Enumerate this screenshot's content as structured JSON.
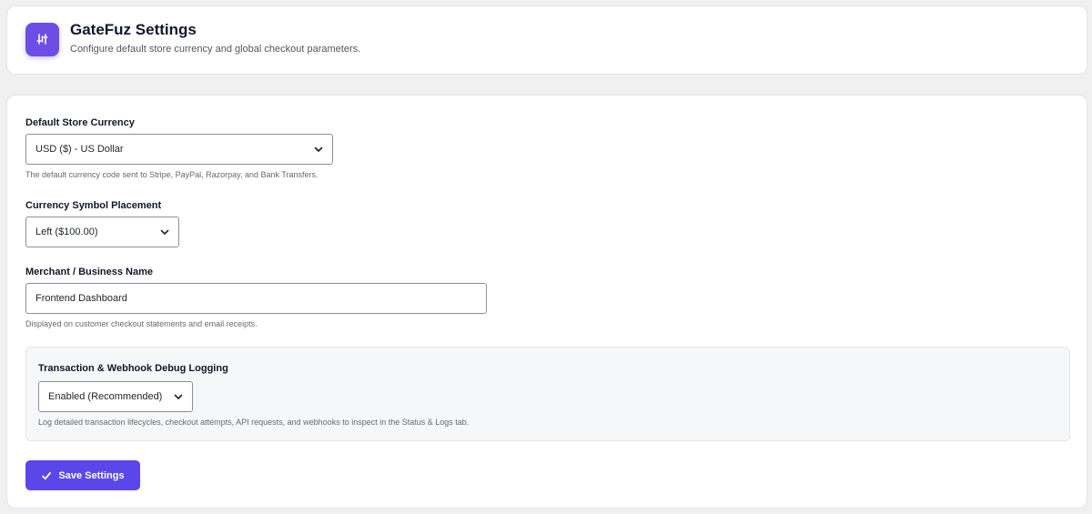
{
  "header": {
    "title": "GateFuz Settings",
    "subtitle": "Configure default store currency and global checkout parameters.",
    "logo_icon": "sliders-icon"
  },
  "settings": {
    "currency": {
      "label": "Default Store Currency",
      "selected": "USD ($) - US Dollar",
      "help": "The default currency code sent to Stripe, PayPal, Razorpay, and Bank Transfers."
    },
    "symbol_placement": {
      "label": "Currency Symbol Placement",
      "selected": "Left ($100.00)"
    },
    "merchant_name": {
      "label": "Merchant / Business Name",
      "value": "Frontend Dashboard",
      "help": "Displayed on customer checkout statements and email receipts."
    },
    "debug_logging": {
      "label": "Transaction & Webhook Debug Logging",
      "selected": "Enabled (Recommended)",
      "help": "Log detailed transaction lifecycles, checkout attempts, API requests, and webhooks to inspect in the Status & Logs tab."
    }
  },
  "actions": {
    "save_label": "Save Settings",
    "save_icon": "checkmark-icon"
  },
  "colors": {
    "accent": "#5b47e9",
    "logo_bg": "#6d4de6",
    "page_bg": "#f0f0f1"
  }
}
